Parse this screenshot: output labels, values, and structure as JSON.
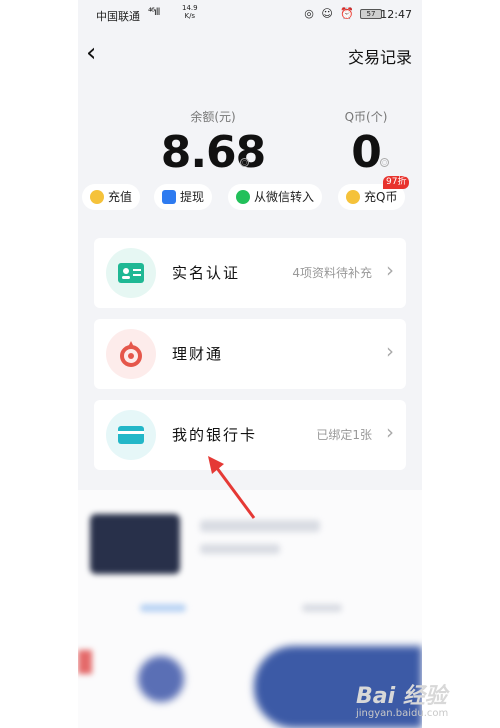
{
  "status": {
    "carrier": "中国联通",
    "signal": "⁴⁶ıll",
    "speed_value": "14.9",
    "speed_unit": "K/s",
    "status_icons": "◎ ☺ ⏰",
    "battery": "57",
    "time": "12:47"
  },
  "header": {
    "back": "‹",
    "records_label": "交易记录"
  },
  "balance": {
    "label": "余额(元)",
    "value": "8.68",
    "qcoin_label": "Q币(个)",
    "qcoin_value": "0"
  },
  "actions": [
    {
      "label": "充值",
      "color": "#f5c23a"
    },
    {
      "label": "提现",
      "color": "#2e7bf0"
    },
    {
      "label": "从微信转入",
      "color": "#22c05a"
    },
    {
      "label": "充Q币",
      "color": "#f5c23a",
      "badge": "97折"
    }
  ],
  "cards": [
    {
      "title": "实名认证",
      "sub": "4项资料待补充",
      "chevron": "›",
      "bg": "#e6f7f3",
      "fg": "#1fb894"
    },
    {
      "title": "理财通",
      "sub": "",
      "chevron": "›",
      "bg": "#fdeceb",
      "fg": "#e5574b"
    },
    {
      "title": "我的银行卡",
      "sub": "已绑定1张",
      "chevron": "›",
      "bg": "#e6f7f8",
      "fg": "#23b7c8"
    }
  ],
  "watermark": {
    "main": "Bai 经验",
    "sub": "jingyan.baidu.com"
  },
  "colors": {
    "background": "#f3f4f7",
    "annotation_arrow": "#e53935"
  }
}
